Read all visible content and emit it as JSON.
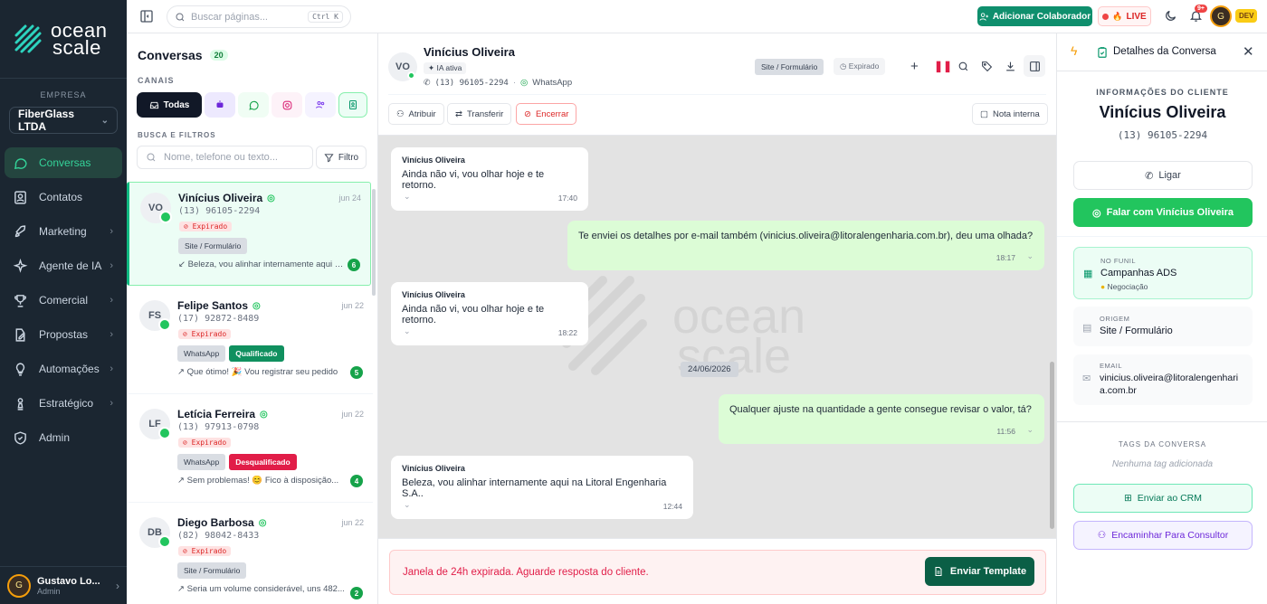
{
  "sidebar": {
    "logo_line1": "ocean",
    "logo_line2": "scale",
    "company_label": "EMPRESA",
    "company_name": "FiberGlass LTDA",
    "items": [
      {
        "label": "Conversas",
        "icon": "chat-bubble-icon",
        "active": true
      },
      {
        "label": "Contatos",
        "icon": "contacts-icon"
      },
      {
        "label": "Marketing",
        "icon": "rocket-icon"
      },
      {
        "label": "Agente de IA",
        "icon": "sparkles-icon"
      },
      {
        "label": "Comercial",
        "icon": "trophy-icon"
      },
      {
        "label": "Propostas",
        "icon": "file-edit-icon"
      },
      {
        "label": "Automações",
        "icon": "lightbulb-icon"
      },
      {
        "label": "Estratégico",
        "icon": "chess-icon"
      },
      {
        "label": "Admin",
        "icon": "shield-icon"
      }
    ],
    "user_name": "Gustavo Lo...",
    "user_role": "Admin"
  },
  "topbar": {
    "search_placeholder": "Buscar páginas...",
    "search_shortcut": "Ctrl K",
    "add_collaborator": "Adicionar Colaborador",
    "live_label": "LIVE",
    "notif_count": "9+",
    "env_badge": "DEV"
  },
  "convlist": {
    "title": "Conversas",
    "count": "20",
    "channels_label": "CANAIS",
    "all_label": "Todas",
    "filters_label": "BUSCA E FILTROS",
    "search_placeholder": "Nome, telefone ou texto...",
    "filter_label": "Filtro",
    "conversations": [
      {
        "initials": "VO",
        "name": "Vinícius Oliveira",
        "date": "jun 24",
        "phone": "(13) 96105-2294",
        "status": "Expirado",
        "tags": [
          {
            "text": "Site / Formulário",
            "style": "gray"
          }
        ],
        "preview": "Beleza, vou alinhar internamente aqui na Litoral Engenharia S.A..",
        "unread": "6"
      },
      {
        "initials": "FS",
        "name": "Felipe Santos",
        "date": "jun 22",
        "phone": "(17) 92872-8489",
        "status": "Expirado",
        "tags": [
          {
            "text": "WhatsApp",
            "style": "gray"
          },
          {
            "text": "Qualificado",
            "style": "green"
          }
        ],
        "preview": "Que ótimo! 🎉 Vou registrar seu pedido",
        "unread": "5"
      },
      {
        "initials": "LF",
        "name": "Letícia Ferreira",
        "date": "jun 22",
        "phone": "(13) 97913-0798",
        "status": "Expirado",
        "tags": [
          {
            "text": "WhatsApp",
            "style": "gray"
          },
          {
            "text": "Desqualificado",
            "style": "red"
          }
        ],
        "preview": "Sem problemas! 😊 Fico à disposição...",
        "unread": "4"
      },
      {
        "initials": "DB",
        "name": "Diego Barbosa",
        "date": "jun 22",
        "phone": "(82) 98042-8433",
        "status": "Expirado",
        "tags": [
          {
            "text": "Site / Formulário",
            "style": "gray"
          }
        ],
        "preview": "Seria um volume considerável, uns 482...",
        "unread": "2"
      }
    ]
  },
  "chat": {
    "contact_initials": "VO",
    "contact_name": "Vinícius Oliveira",
    "ai_badge": "IA ativa",
    "phone": "(13) 96105-2294",
    "channel": "WhatsApp",
    "source_tag": "Site / Formulário",
    "status": "Expirado",
    "assign": "Atribuir",
    "transfer": "Transferir",
    "close": "Encerrar",
    "internal_note": "Nota interna",
    "date_separator": "24/06/2026",
    "messages": [
      {
        "dir": "in",
        "sender": "Vinícius Oliveira",
        "text": "Ainda não vi, vou olhar hoje e te retorno.",
        "time": "17:40"
      },
      {
        "dir": "out",
        "text": "Te enviei os detalhes por e-mail também (vinicius.oliveira@litoralengenharia.com.br), deu uma olhada?",
        "time": "18:17"
      },
      {
        "dir": "in",
        "sender": "Vinícius Oliveira",
        "text": "Ainda não vi, vou olhar hoje e te retorno.",
        "time": "18:22"
      },
      {
        "dir": "out",
        "text": "Qualquer ajuste na quantidade a gente consegue revisar o valor, tá?",
        "time": "11:56"
      },
      {
        "dir": "in",
        "sender": "Vinícius Oliveira",
        "text": "Beleza, vou alinhar internamente aqui na Litoral Engenharia S.A..",
        "time": "12:44"
      }
    ],
    "expired_notice": "Janela de 24h expirada. Aguarde resposta do cliente.",
    "send_template": "Enviar Template"
  },
  "details": {
    "title": "Detalhes da Conversa",
    "client_info_label": "INFORMAÇÕES DO CLIENTE",
    "client_name": "Vinícius Oliveira",
    "client_phone": "(13) 96105-2294",
    "call_label": "Ligar",
    "whatsapp_label": "Falar com Vinícius Oliveira",
    "funnel_label": "NO FUNIL",
    "funnel_value": "Campanhas ADS",
    "funnel_stage": "Negociação",
    "origin_label": "ORIGEM",
    "origin_value": "Site / Formulário",
    "email_label": "EMAIL",
    "email_line1": "vinicius.oliveira@litoralengenhari",
    "email_line2": "a.com.br",
    "tags_label": "TAGS DA CONVERSA",
    "no_tags": "Nenhuma tag adicionada",
    "send_crm": "Enviar ao CRM",
    "forward_consultant": "Encaminhar Para Consultor"
  }
}
